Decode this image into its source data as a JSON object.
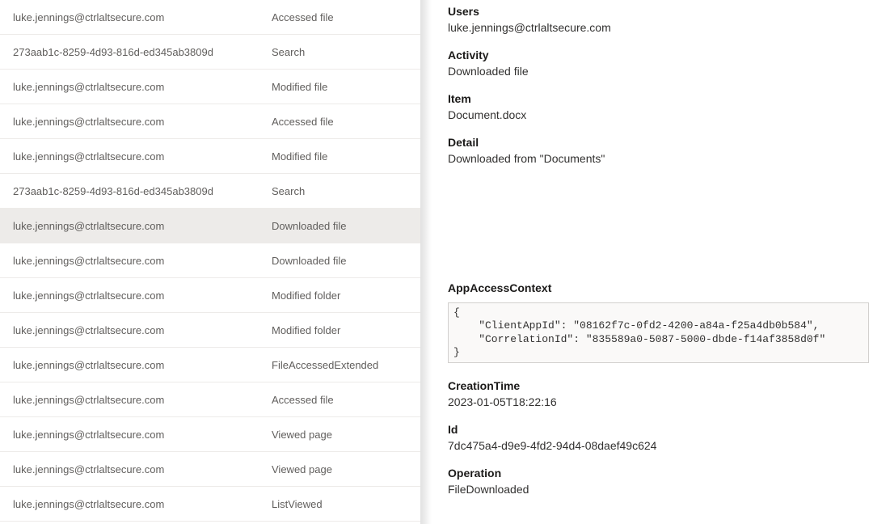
{
  "audit_rows": [
    {
      "user": "luke.jennings@ctrlaltsecure.com",
      "activity": "Accessed file",
      "selected": false
    },
    {
      "user": "273aab1c-8259-4d93-816d-ed345ab3809d",
      "activity": "Search",
      "selected": false
    },
    {
      "user": "luke.jennings@ctrlaltsecure.com",
      "activity": "Modified file",
      "selected": false
    },
    {
      "user": "luke.jennings@ctrlaltsecure.com",
      "activity": "Accessed file",
      "selected": false
    },
    {
      "user": "luke.jennings@ctrlaltsecure.com",
      "activity": "Modified file",
      "selected": false
    },
    {
      "user": "273aab1c-8259-4d93-816d-ed345ab3809d",
      "activity": "Search",
      "selected": false
    },
    {
      "user": "luke.jennings@ctrlaltsecure.com",
      "activity": "Downloaded file",
      "selected": true
    },
    {
      "user": "luke.jennings@ctrlaltsecure.com",
      "activity": "Downloaded file",
      "selected": false
    },
    {
      "user": "luke.jennings@ctrlaltsecure.com",
      "activity": "Modified folder",
      "selected": false
    },
    {
      "user": "luke.jennings@ctrlaltsecure.com",
      "activity": "Modified folder",
      "selected": false
    },
    {
      "user": "luke.jennings@ctrlaltsecure.com",
      "activity": "FileAccessedExtended",
      "selected": false
    },
    {
      "user": "luke.jennings@ctrlaltsecure.com",
      "activity": "Accessed file",
      "selected": false
    },
    {
      "user": "luke.jennings@ctrlaltsecure.com",
      "activity": "Viewed page",
      "selected": false
    },
    {
      "user": "luke.jennings@ctrlaltsecure.com",
      "activity": "Viewed page",
      "selected": false
    },
    {
      "user": "luke.jennings@ctrlaltsecure.com",
      "activity": "ListViewed",
      "selected": false
    }
  ],
  "detail": {
    "users_label": "Users",
    "users_value": "luke.jennings@ctrlaltsecure.com",
    "activity_label": "Activity",
    "activity_value": "Downloaded file",
    "item_label": "Item",
    "item_value": "Document.docx",
    "detail_label": "Detail",
    "detail_value": "Downloaded from \"Documents\"",
    "appaccess_label": "AppAccessContext",
    "appaccess_code": "{\n    \"ClientAppId\": \"08162f7c-0fd2-4200-a84a-f25a4db0b584\",\n    \"CorrelationId\": \"835589a0-5087-5000-dbde-f14af3858d0f\"\n}",
    "creationtime_label": "CreationTime",
    "creationtime_value": "2023-01-05T18:22:16",
    "id_label": "Id",
    "id_value": "7dc475a4-d9e9-4fd2-94d4-08daef49c624",
    "operation_label": "Operation",
    "operation_value": "FileDownloaded"
  }
}
